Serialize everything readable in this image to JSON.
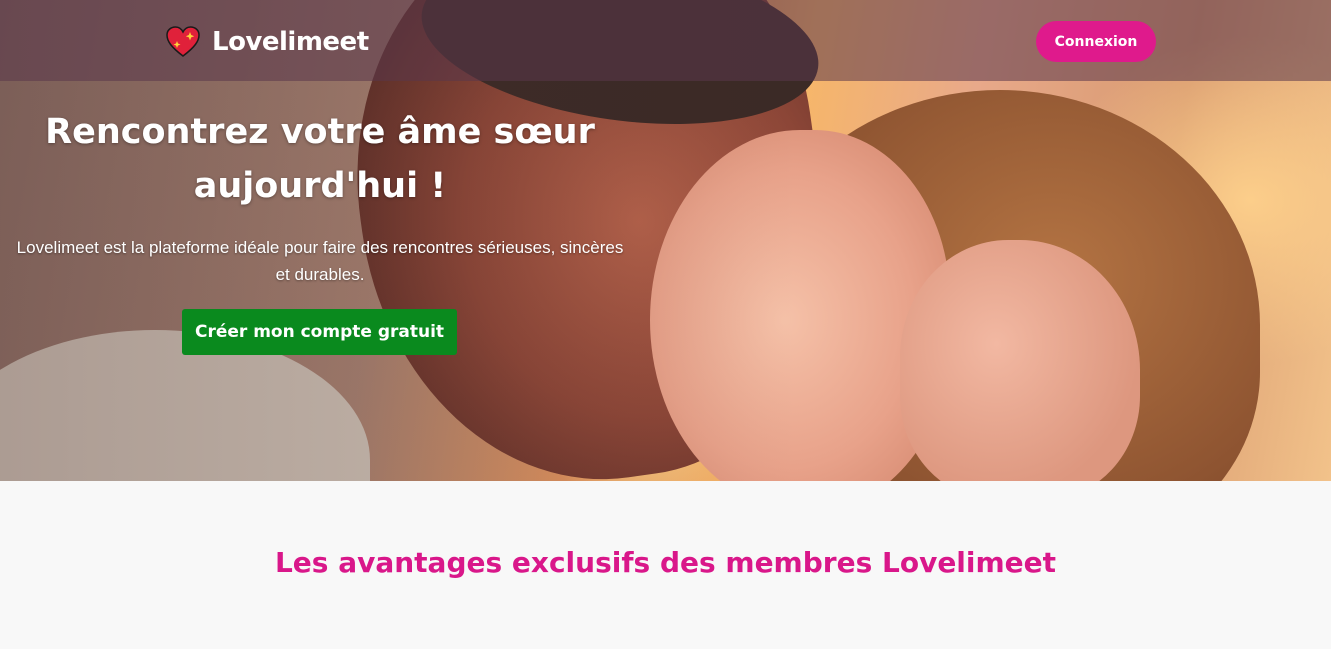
{
  "brand": {
    "name": "Lovelimeet",
    "accent": "#df1a8c",
    "cta_color": "#0a8a1e",
    "logo_icon": "sparkle-heart-icon"
  },
  "nav": {
    "login_label": "Connexion"
  },
  "hero": {
    "title": "Rencontrez votre âme sœur aujourd'hui !",
    "subtitle": "Lovelimeet est la plateforme idéale pour faire des rencontres sérieuses, sincères et durables.",
    "cta_label": "Créer mon compte gratuit"
  },
  "benefits": {
    "title": "Les avantages exclusifs des membres Lovelimeet"
  }
}
